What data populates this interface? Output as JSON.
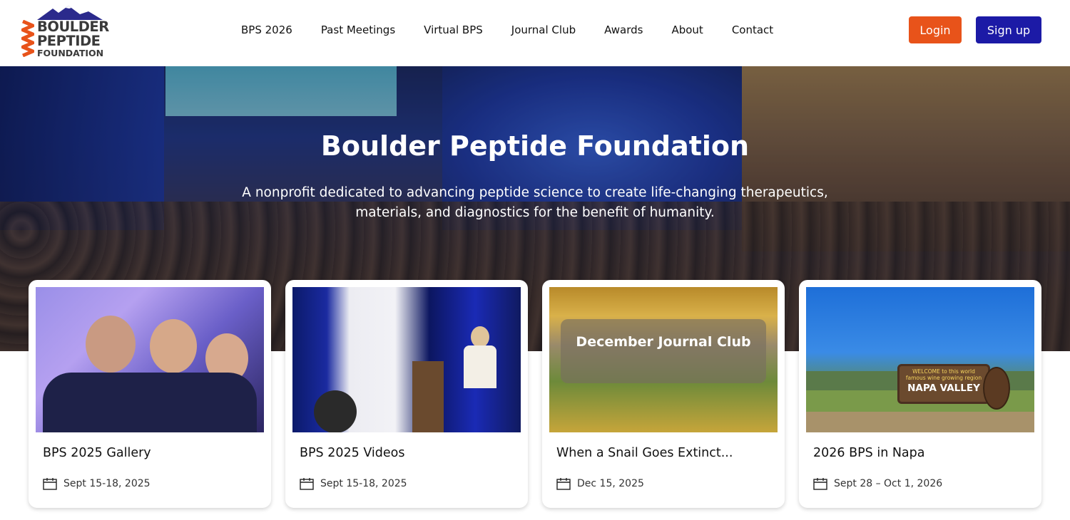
{
  "logo": {
    "line1": "BOULDER",
    "line2": "PEPTIDE",
    "line3": "FOUNDATION"
  },
  "nav": {
    "items": [
      "BPS 2026",
      "Past Meetings",
      "Virtual BPS",
      "Journal Club",
      "Awards",
      "About",
      "Contact"
    ]
  },
  "auth": {
    "login_label": "Login",
    "signup_label": "Sign up"
  },
  "hero": {
    "title": "Boulder Peptide Foundation",
    "subtitle": "A nonprofit dedicated to advancing peptide science to create life-changing therapeutics, materials, and diagnostics for the benefit of humanity."
  },
  "cards": [
    {
      "title": "BPS 2025 Gallery",
      "date": "Sept 15-18, 2025"
    },
    {
      "title": "BPS 2025 Videos",
      "date": "Sept 15-18, 2025"
    },
    {
      "title": "When a Snail Goes Extinct...",
      "date": "Dec 15, 2025",
      "overlay": "December Journal Club"
    },
    {
      "title": "2026 BPS in Napa",
      "date": "Sept 28 – Oct 1, 2026",
      "sign_title": "NAPA VALLEY",
      "sign_small": "WELCOME to this world famous wine growing region"
    }
  ],
  "colors": {
    "login": "#e8531a",
    "signup": "#1c1aa6",
    "logo_accent": "#e8531a",
    "logo_mountain": "#2b2a8c"
  }
}
